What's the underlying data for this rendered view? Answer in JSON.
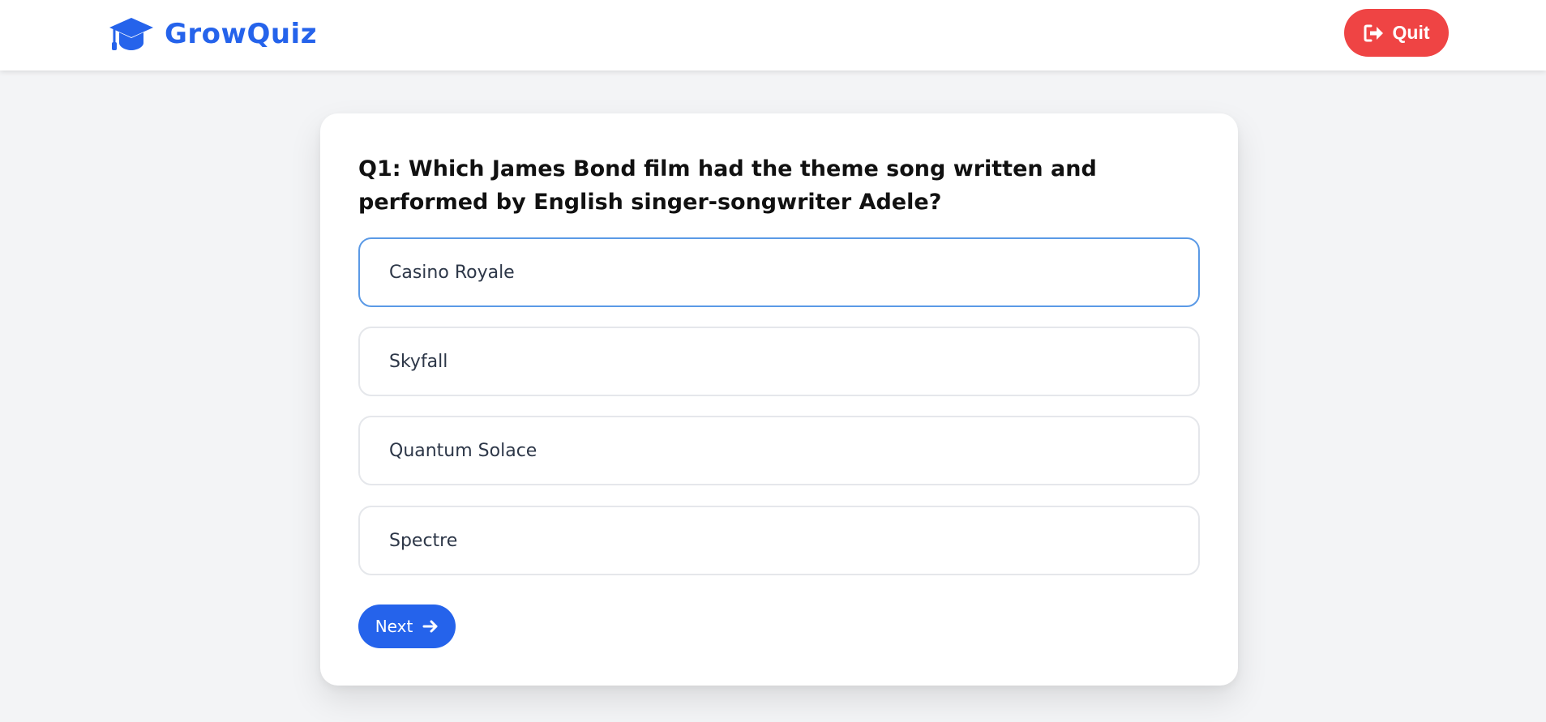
{
  "brand": {
    "name": "GrowQuiz",
    "icon": "graduation-cap-icon",
    "color": "#2563eb"
  },
  "header": {
    "quit_label": "Quit",
    "quit_icon": "sign-out-icon",
    "quit_color": "#ef4444"
  },
  "question": {
    "text": "Q1: Which James Bond film had the theme song written and performed by English singer-songwriter Adele?"
  },
  "options": [
    {
      "label": "Casino Royale",
      "highlighted": true
    },
    {
      "label": "Skyfall",
      "highlighted": false
    },
    {
      "label": "Quantum Solace",
      "highlighted": false
    },
    {
      "label": "Spectre",
      "highlighted": false
    }
  ],
  "footer": {
    "next_label": "Next",
    "next_icon": "arrow-right-icon",
    "next_color": "#2563eb"
  }
}
